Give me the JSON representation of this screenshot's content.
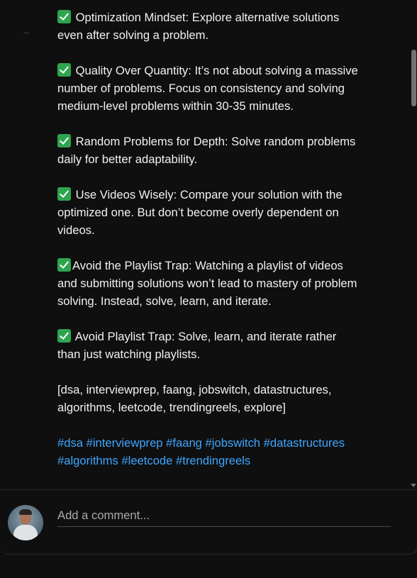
{
  "description": {
    "paragraphs": [
      {
        "check": true,
        "text": " Optimization Mindset: Explore alternative solutions even after solving a problem."
      },
      {
        "check": true,
        "text": " Quality Over Quantity: It’s not about solving a massive number of problems. Focus on consistency and solving medium-level problems within 30-35 minutes."
      },
      {
        "check": true,
        "text": " Random Problems for Depth: Solve random problems daily for better adaptability."
      },
      {
        "check": true,
        "text": " Use Videos Wisely: Compare your solution with the optimized one. But don’t become overly dependent on videos."
      },
      {
        "check": true,
        "text": "Avoid the Playlist Trap: Watching a playlist of videos and submitting solutions won’t lead to mastery of problem solving. Instead, solve, learn, and iterate."
      },
      {
        "check": true,
        "text": " Avoid Playlist Trap: Solve, learn, and iterate rather than just watching playlists."
      },
      {
        "check": false,
        "text": "[dsa, interviewprep, faang, jobswitch, datastructures, algorithms, leetcode, trendingreels, explore]"
      }
    ],
    "hashtags": [
      "#dsa",
      "#interviewprep",
      "#faang",
      "#jobswitch",
      "#datastructures",
      "#algorithms",
      "#leetcode",
      "#trendingreels"
    ]
  },
  "comment_box": {
    "placeholder": "Add a comment..."
  },
  "icons": {
    "check": "check-mark-icon",
    "avatar": "user-avatar"
  },
  "colors": {
    "background": "#0f0f0f",
    "text": "#f1f1f1",
    "hashtag": "#3ea6ff",
    "check": "#2fa44f"
  }
}
